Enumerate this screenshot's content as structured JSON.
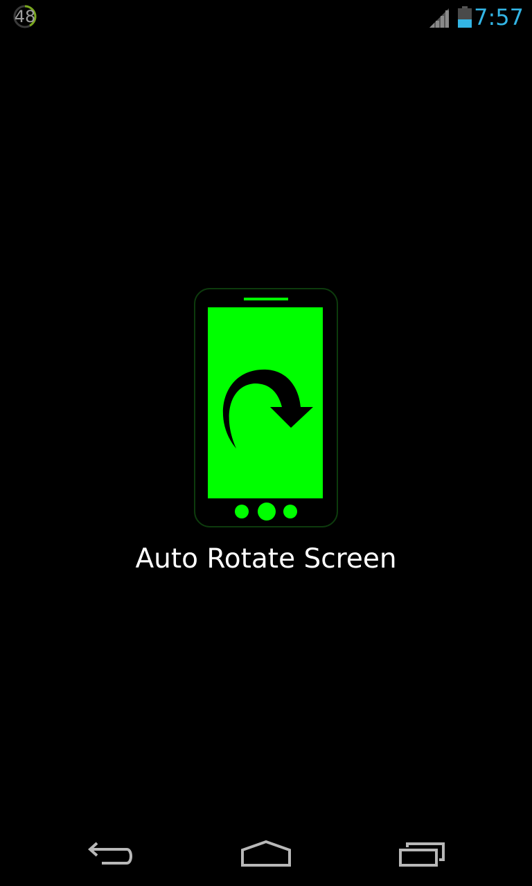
{
  "status_bar": {
    "notification_count": "48",
    "time": "7:57",
    "signal_icon": "cell-signal-icon",
    "battery_icon": "battery-icon",
    "time_color": "#33b5e5"
  },
  "main": {
    "app_icon": "phone-rotate-icon",
    "app_label": "Auto Rotate Screen",
    "accent_color": "#00ff00"
  },
  "nav_bar": {
    "back_icon": "back-arrow-icon",
    "home_icon": "home-icon",
    "recents_icon": "recent-apps-icon"
  }
}
